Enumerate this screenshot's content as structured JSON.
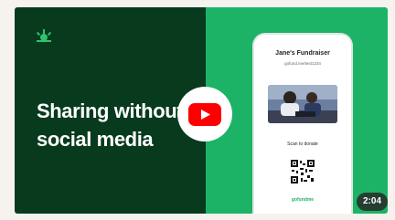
{
  "video": {
    "headline_line1": "Sharing without",
    "headline_line2": "social media",
    "duration": "2:04",
    "play_icon": "youtube-play-icon",
    "logo_icon": "gofundme-sprout-icon"
  },
  "phone": {
    "title": "Jane's Fundraiser",
    "url": "gofund.me/test1234",
    "scan_label": "Scan to donate",
    "brand": "gofundme"
  },
  "colors": {
    "left_bg": "#083a1e",
    "right_bg": "#1cb366",
    "accent": "#2fc46b",
    "youtube_red": "#ff0000"
  }
}
